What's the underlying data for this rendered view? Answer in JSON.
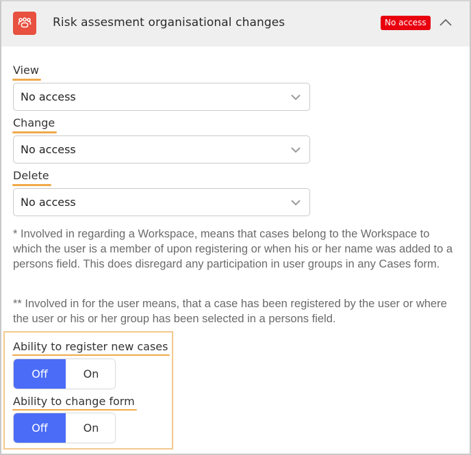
{
  "header": {
    "icon": "group-icon",
    "title": "Risk assesment organisational changes",
    "badge": "No access",
    "collapse_icon": "chevron-up-icon"
  },
  "fields": [
    {
      "label": "View",
      "value": "No access"
    },
    {
      "label": "Change",
      "value": "No access"
    },
    {
      "label": "Delete",
      "value": "No access"
    }
  ],
  "notes": [
    "* Involved in regarding a Workspace, means that cases belong to the Workspace to which the user is a member of upon registering or when his or her name was added to a persons field. This does disregard any participation in user groups in any Cases form.",
    "** Involved in for the user means, that a case has been registered by the user or where the user or his or her group has been selected in a persons field."
  ],
  "toggles": [
    {
      "label": "Ability to register new cases",
      "off_label": "Off",
      "on_label": "On",
      "selected": "Off"
    },
    {
      "label": "Ability to change form",
      "off_label": "Off",
      "on_label": "On",
      "selected": "Off"
    }
  ],
  "colors": {
    "icon_bg": "#e8503f",
    "badge_bg": "#e8000e",
    "toggle_active": "#4a6cf7",
    "underline": "#f0a94a",
    "highlight_border": "#f3c88e"
  }
}
